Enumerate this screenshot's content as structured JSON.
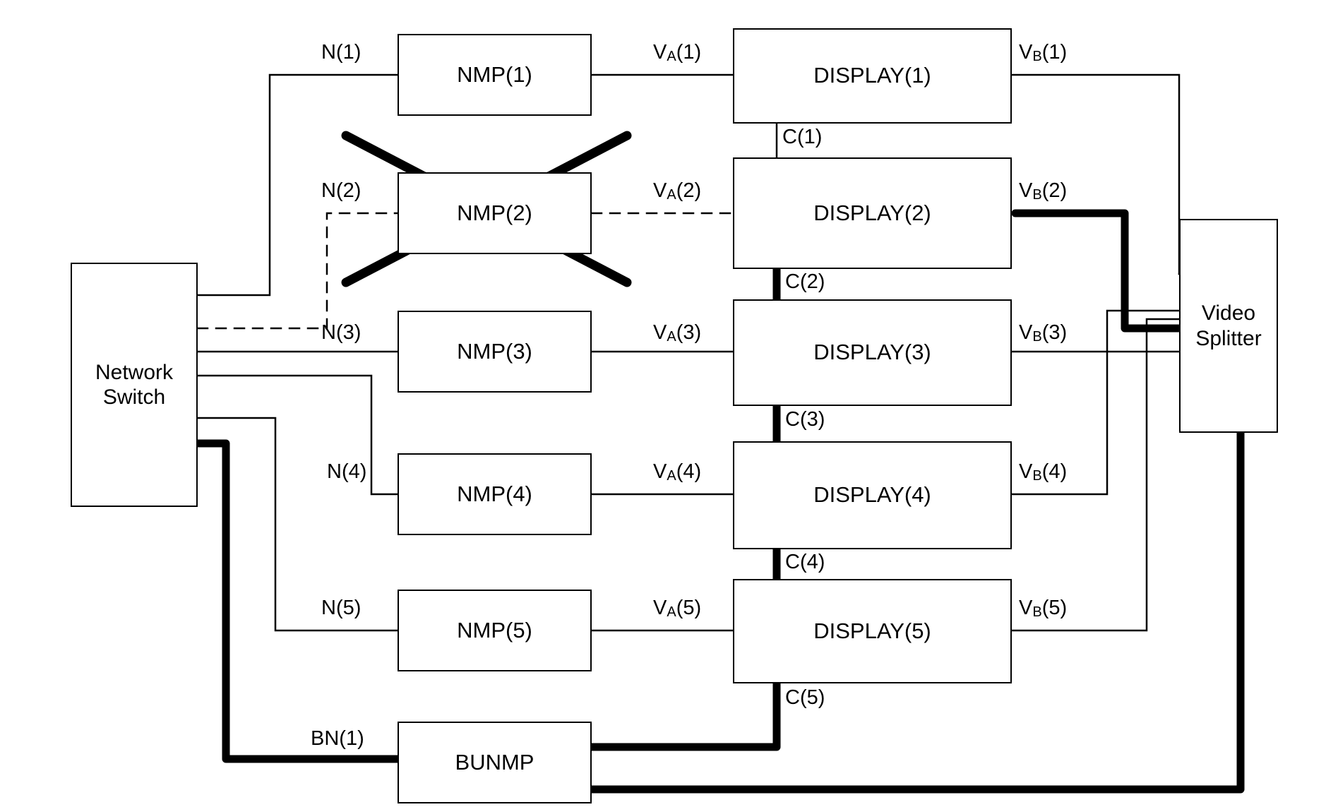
{
  "diagram": {
    "title": "Network media player and display distribution block diagram",
    "type": "block-diagram",
    "background_color": "#ffffff",
    "line_color": "#000000"
  },
  "nodes": {
    "network_switch": {
      "label_line1": "Network",
      "label_line2": "Switch"
    },
    "video_splitter": {
      "label_line1": "Video",
      "label_line2": "Splitter"
    },
    "nmp": [
      {
        "label": "NMP(1)"
      },
      {
        "label": "NMP(2)",
        "crossed_out": true
      },
      {
        "label": "NMP(3)"
      },
      {
        "label": "NMP(4)"
      },
      {
        "label": "NMP(5)"
      }
    ],
    "displays": [
      {
        "label": "DISPLAY(1)"
      },
      {
        "label": "DISPLAY(2)"
      },
      {
        "label": "DISPLAY(3)"
      },
      {
        "label": "DISPLAY(4)"
      },
      {
        "label": "DISPLAY(5)"
      }
    ],
    "backup": {
      "label": "BUNMP"
    }
  },
  "edge_labels": {
    "network_links": [
      {
        "text": "N(1)",
        "style": "solid"
      },
      {
        "text": "N(2)",
        "style": "dashed"
      },
      {
        "text": "N(3)",
        "style": "solid"
      },
      {
        "text": "N(4)",
        "style": "solid"
      },
      {
        "text": "N(5)",
        "style": "solid"
      }
    ],
    "backup_network_link": {
      "text": "BN(1)",
      "style": "thick"
    },
    "video_a_links": [
      {
        "base": "V",
        "sub": "A",
        "index": "(1)",
        "style": "solid"
      },
      {
        "base": "V",
        "sub": "A",
        "index": "(2)",
        "style": "dashed"
      },
      {
        "base": "V",
        "sub": "A",
        "index": "(3)",
        "style": "solid"
      },
      {
        "base": "V",
        "sub": "A",
        "index": "(4)",
        "style": "solid"
      },
      {
        "base": "V",
        "sub": "A",
        "index": "(5)",
        "style": "solid"
      }
    ],
    "video_b_links": [
      {
        "base": "V",
        "sub": "B",
        "index": "(1)",
        "style": "solid"
      },
      {
        "base": "V",
        "sub": "B",
        "index": "(2)",
        "style": "thick"
      },
      {
        "base": "V",
        "sub": "B",
        "index": "(3)",
        "style": "solid"
      },
      {
        "base": "V",
        "sub": "B",
        "index": "(4)",
        "style": "solid"
      },
      {
        "base": "V",
        "sub": "B",
        "index": "(5)",
        "style": "solid"
      }
    ],
    "control_links": [
      {
        "text": "C(1)",
        "style": "thin"
      },
      {
        "text": "C(2)",
        "style": "thick"
      },
      {
        "text": "C(3)",
        "style": "thick"
      },
      {
        "text": "C(4)",
        "style": "thick"
      },
      {
        "text": "C(5)",
        "style": "thick"
      }
    ]
  }
}
